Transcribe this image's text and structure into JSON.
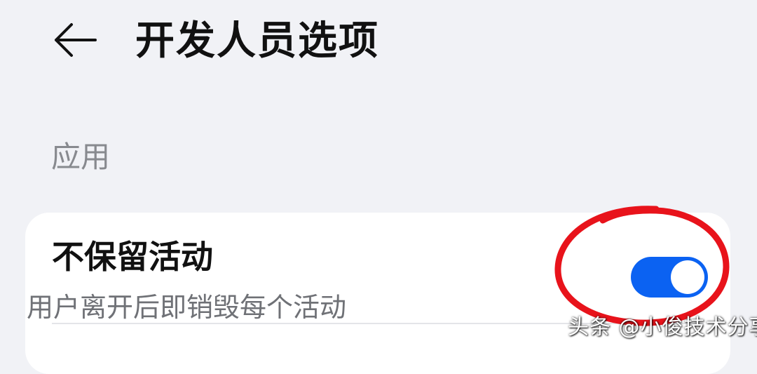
{
  "header": {
    "back_icon": "arrow-left-icon",
    "title": "开发人员选项"
  },
  "section": {
    "label": "应用"
  },
  "setting": {
    "title": "不保留活动",
    "description": "用户离开后即销毁每个活动",
    "enabled": true
  },
  "colors": {
    "background": "#f1f2f6",
    "toggle_on": "#0b62f2",
    "highlight": "#e8131b"
  },
  "watermark": {
    "text": "头条 @小俊技术分享"
  }
}
